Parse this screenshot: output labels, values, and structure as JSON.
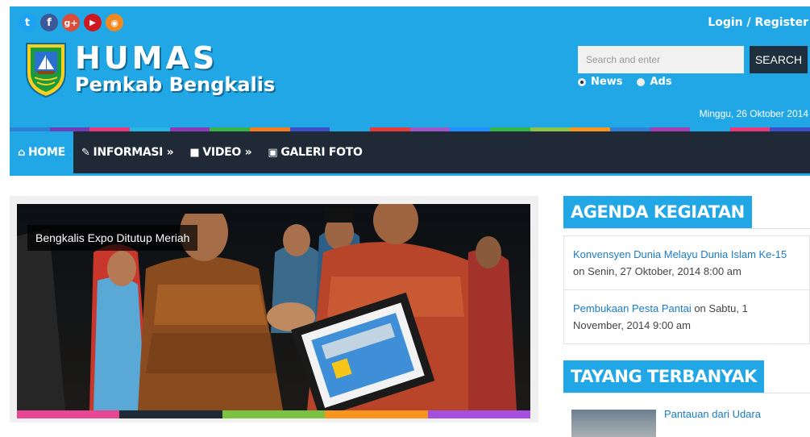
{
  "header": {
    "social": [
      {
        "name": "twitter-icon",
        "glyph": "t",
        "color": "#1da1f2"
      },
      {
        "name": "facebook-icon",
        "glyph": "f",
        "color": "#3b5998"
      },
      {
        "name": "google-plus-icon",
        "glyph": "g+",
        "color": "#dd4b39"
      },
      {
        "name": "youtube-icon",
        "glyph": "▶",
        "color": "#cc181e"
      },
      {
        "name": "rss-icon",
        "glyph": "◉",
        "color": "#f2891f"
      }
    ],
    "brand_title": "HUMAS",
    "brand_subtitle": "Pemkab Bengkalis",
    "login_text": "Login / Register",
    "search_placeholder": "Search and enter",
    "search_button": "SEARCH",
    "radio_news": "News",
    "radio_ads": "Ads",
    "date": "Minggu, 26 Oktober 2014"
  },
  "nav": {
    "items": [
      {
        "label": "HOME",
        "icon": "home-icon",
        "active": true
      },
      {
        "label": "INFORMASI »",
        "icon": "edit-icon"
      },
      {
        "label": "VIDEO »",
        "icon": "video-icon"
      },
      {
        "label": "GALERI FOTO",
        "icon": "camera-icon"
      }
    ]
  },
  "slider": {
    "caption": "Bengkalis Expo Ditutup Meriah"
  },
  "sidebar": {
    "agenda_title": "AGENDA KEGIATAN",
    "agenda": [
      {
        "title": "Konvensyen Dunia Melayu Dunia Islam Ke-15",
        "when": " on Senin, 27 Oktober, 2014 8:00 am"
      },
      {
        "title": "Pembukaan Pesta Pantai",
        "when": " on Sabtu, 1 November, 2014 9:00 am"
      }
    ],
    "popular_title": "TAYANG TERBANYAK",
    "popular": [
      {
        "title": "Pantauan dari Udara"
      }
    ]
  },
  "colors": {
    "header_blue": "#22a7e6",
    "nav_dark": "#1f2a36",
    "stripe": [
      "#2f7fd6",
      "#6d3fb5",
      "#e7397b",
      "#27b6e3",
      "#8b3ab3",
      "#38b34a",
      "#f47c20",
      "#3b4fc7",
      "#22a7e6",
      "#e53b3b",
      "#9c58c4",
      "#1e90ff",
      "#36b44a",
      "#8bc34a",
      "#f7941d",
      "#2f7fd6",
      "#a43fb0",
      "#22a7e6",
      "#e7397b",
      "#3b4fc7"
    ],
    "slide_bar": [
      "#e54793",
      "#1f2a36",
      "#7cc242",
      "#f7941d",
      "#a54fe0"
    ]
  }
}
